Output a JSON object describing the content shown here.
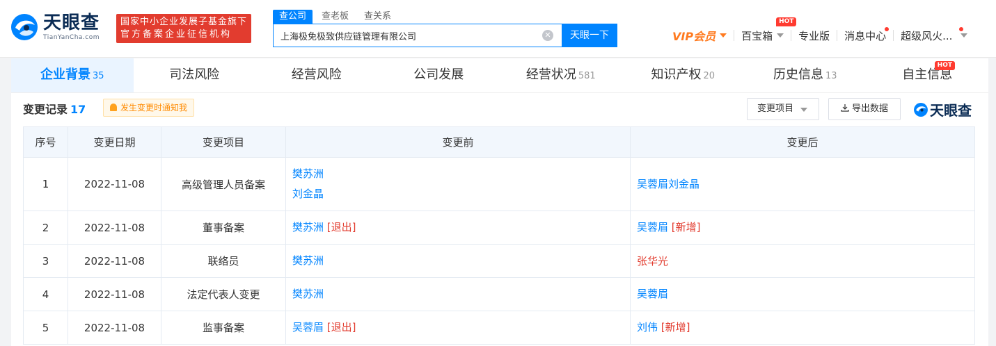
{
  "brand": {
    "name": "天眼查",
    "domain": "TianYanCha.com",
    "badge_line1": "国家中小企业发展子基金旗下",
    "badge_line2": "官方备案企业征信机构"
  },
  "search": {
    "tabs": [
      "查公司",
      "查老板",
      "查关系"
    ],
    "value": "上海极免极致供应链管理有限公司",
    "button": "天眼一下"
  },
  "top_nav": {
    "vip": "VIP会员",
    "treasure": "百宝箱",
    "hot": "HOT",
    "pro": "专业版",
    "messages": "消息中心",
    "user": "超级风火..."
  },
  "tabs": [
    {
      "label": "企业背景",
      "count": "35"
    },
    {
      "label": "司法风险",
      "count": ""
    },
    {
      "label": "经营风险",
      "count": ""
    },
    {
      "label": "公司发展",
      "count": ""
    },
    {
      "label": "经营状况",
      "count": "581"
    },
    {
      "label": "知识产权",
      "count": "20"
    },
    {
      "label": "历史信息",
      "count": "13"
    },
    {
      "label": "自主信息",
      "count": ""
    }
  ],
  "section": {
    "title": "变更记录",
    "count": "17",
    "notify": "发生变更时通知我",
    "filter": "变更项目",
    "export": "导出数据",
    "watermark": "天眼查"
  },
  "table": {
    "headers": [
      "序号",
      "变更日期",
      "变更项目",
      "变更前",
      "变更后"
    ],
    "rows": [
      {
        "no": "1",
        "date": "2022-11-08",
        "item": "高级管理人员备案",
        "before": [
          "樊苏洲",
          "刘金晶"
        ],
        "before_tag": "",
        "after": "吴蓉眉刘金晶",
        "after_tag": ""
      },
      {
        "no": "2",
        "date": "2022-11-08",
        "item": "董事备案",
        "before": [
          "樊苏洲"
        ],
        "before_tag": "[退出]",
        "after": "吴蓉眉",
        "after_tag": "[新增]"
      },
      {
        "no": "3",
        "date": "2022-11-08",
        "item": "联络员",
        "before": [
          "樊苏洲"
        ],
        "before_tag": "",
        "after": "张华光",
        "after_tag": ""
      },
      {
        "no": "4",
        "date": "2022-11-08",
        "item": "法定代表人变更",
        "before": [
          "樊苏洲"
        ],
        "before_tag": "",
        "after": "吴蓉眉",
        "after_tag": ""
      },
      {
        "no": "5",
        "date": "2022-11-08",
        "item": "监事备案",
        "before": [
          "吴蓉眉"
        ],
        "before_tag": "[退出]",
        "after": "刘伟",
        "after_tag": "[新增]"
      }
    ]
  },
  "colors": {
    "accent": "#0084ff",
    "badge": "#e23c2f",
    "vip": "#ff7a1f"
  }
}
